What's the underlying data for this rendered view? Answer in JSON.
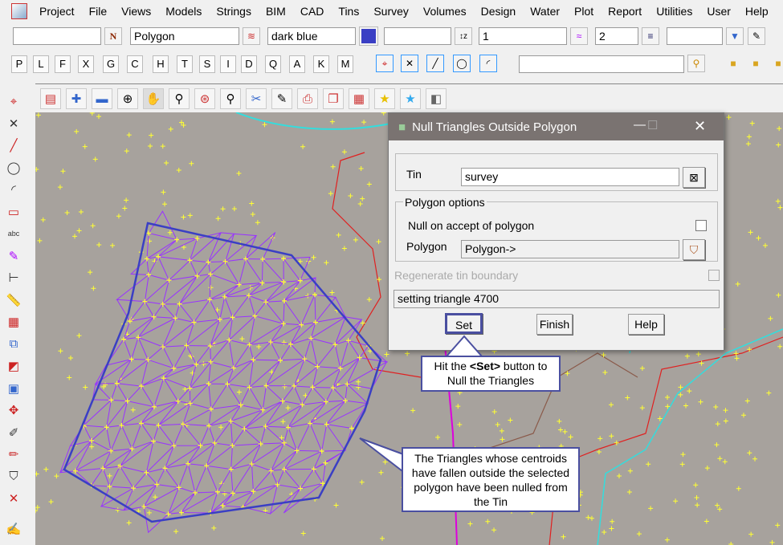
{
  "menu": [
    "Project",
    "File",
    "Views",
    "Models",
    "Strings",
    "BIM",
    "CAD",
    "Tins",
    "Survey",
    "Volumes",
    "Design",
    "Water",
    "Plot",
    "Report",
    "Utilities",
    "User",
    "Help"
  ],
  "toolbar": {
    "model_value": "",
    "name_button": "N",
    "string_name": "Polygon",
    "colour": "dark blue",
    "colour_hex": "#3a3fc4",
    "z_value": "",
    "weight": "1",
    "linestyle": "2",
    "style_value": "",
    "search_value": ""
  },
  "letters": [
    "P",
    "L",
    "F",
    "X",
    "G",
    "C",
    "H",
    "T",
    "S",
    "I",
    "D",
    "Q",
    "A",
    "K",
    "M"
  ],
  "dialog": {
    "title": "Null Triangles Outside Polygon",
    "tin_label": "Tin",
    "tin_value": "survey",
    "group_label": "Polygon options",
    "null_label": "Null on accept of polygon",
    "polygon_label": "Polygon",
    "polygon_value": "Polygon->",
    "regen_label": "Regenerate tin boundary",
    "status": "setting triangle 4700",
    "set": "Set",
    "finish": "Finish",
    "help": "Help"
  },
  "callouts": {
    "set_pre": "Hit the ",
    "set_bold": "<Set>",
    "set_post": " button to Null the Triangles",
    "nulled": "The Triangles whose centroids have fallen outside the selected polygon have been nulled from the Tin"
  },
  "colors": {
    "map_bg": "#a7a29d",
    "points": "#ffff33",
    "triangles": "#9933ff",
    "polygon": "#3a3fc4",
    "contour_red": "#e02020",
    "road_cyan": "#33dddd"
  }
}
